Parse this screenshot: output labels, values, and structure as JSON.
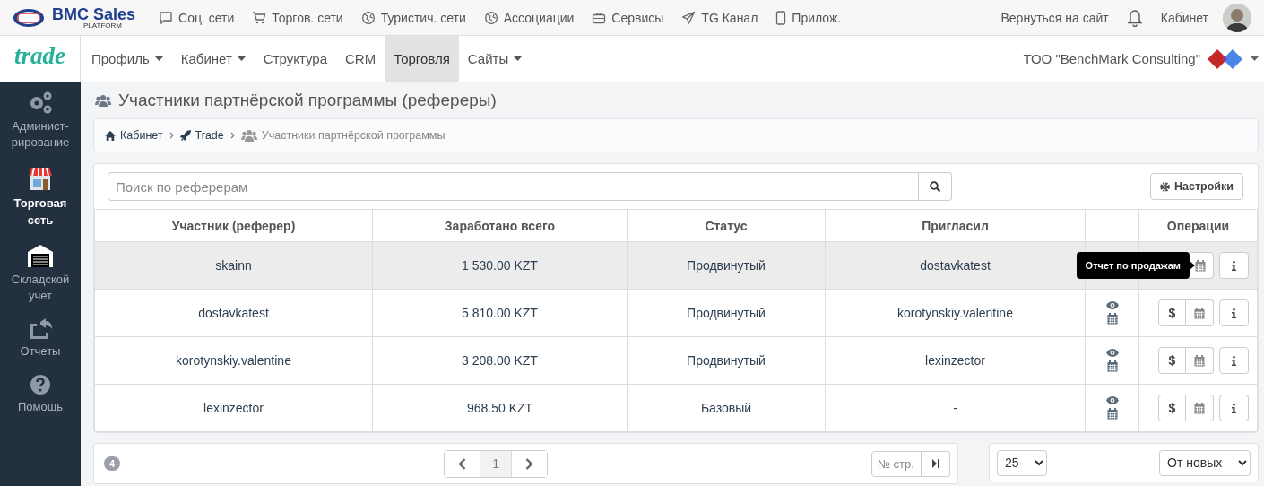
{
  "topbar": {
    "brand": "BMC Sales",
    "brand_sub": "PLATFORM",
    "links": [
      "Соц. сети",
      "Торгов. сети",
      "Туристич. сети",
      "Ассоциации",
      "Сервисы",
      "TG Канал",
      "Прилож."
    ],
    "back_link": "Вернуться на сайт",
    "cabinet": "Кабинет"
  },
  "navbar": {
    "logo": "trade",
    "items": [
      {
        "label": "Профиль",
        "dropdown": true,
        "selected": false
      },
      {
        "label": "Кабинет",
        "dropdown": true,
        "selected": false
      },
      {
        "label": "Структура",
        "dropdown": false,
        "selected": false
      },
      {
        "label": "CRM",
        "dropdown": false,
        "selected": false
      },
      {
        "label": "Торговля",
        "dropdown": false,
        "selected": true
      },
      {
        "label": "Сайты",
        "dropdown": true,
        "selected": false
      }
    ],
    "company": "ТОО \"BenchMark Consulting\""
  },
  "sidebar": {
    "items": [
      {
        "label": "Админист-рирование",
        "selected": false
      },
      {
        "label": "Торговая сеть",
        "selected": true
      },
      {
        "label": "Складской учет",
        "selected": false
      },
      {
        "label": "Отчеты",
        "selected": false
      },
      {
        "label": "Помощь",
        "selected": false
      }
    ]
  },
  "page_title": "Участники партнёрской программы (рефереры)",
  "breadcrumb": [
    "Кабинет",
    "Trade",
    "Участники партнёрской программы"
  ],
  "search": {
    "placeholder": "Поиск по реферерам"
  },
  "settings_button": "Настройки",
  "table": {
    "columns": [
      "Участник (реферер)",
      "Заработано всего",
      "Статус",
      "Пригласил",
      "Операции"
    ],
    "rows": [
      {
        "participant": "skainn",
        "earned": "1 530.00 KZT",
        "status": "Продвинутый",
        "invited_by": "dostavkatest",
        "hover": true,
        "tooltip": "Отчет по продажам"
      },
      {
        "participant": "dostavkatest",
        "earned": "5 810.00 KZT",
        "status": "Продвинутый",
        "invited_by": "korotynskiy.valentine",
        "hover": false,
        "money": "$"
      },
      {
        "participant": "korotynskiy.valentine",
        "earned": "3 208.00 KZT",
        "status": "Продвинутый",
        "invited_by": "lexinzector",
        "hover": false,
        "money": "$"
      },
      {
        "participant": "lexinzector",
        "earned": "968.50 KZT",
        "status": "Базовый",
        "invited_by": "-",
        "hover": false,
        "money": "$"
      }
    ]
  },
  "pagination": {
    "count": "4",
    "current_page": "1",
    "page_input_placeholder": "№ стр."
  },
  "per_page": "25",
  "sort": "От новых"
}
